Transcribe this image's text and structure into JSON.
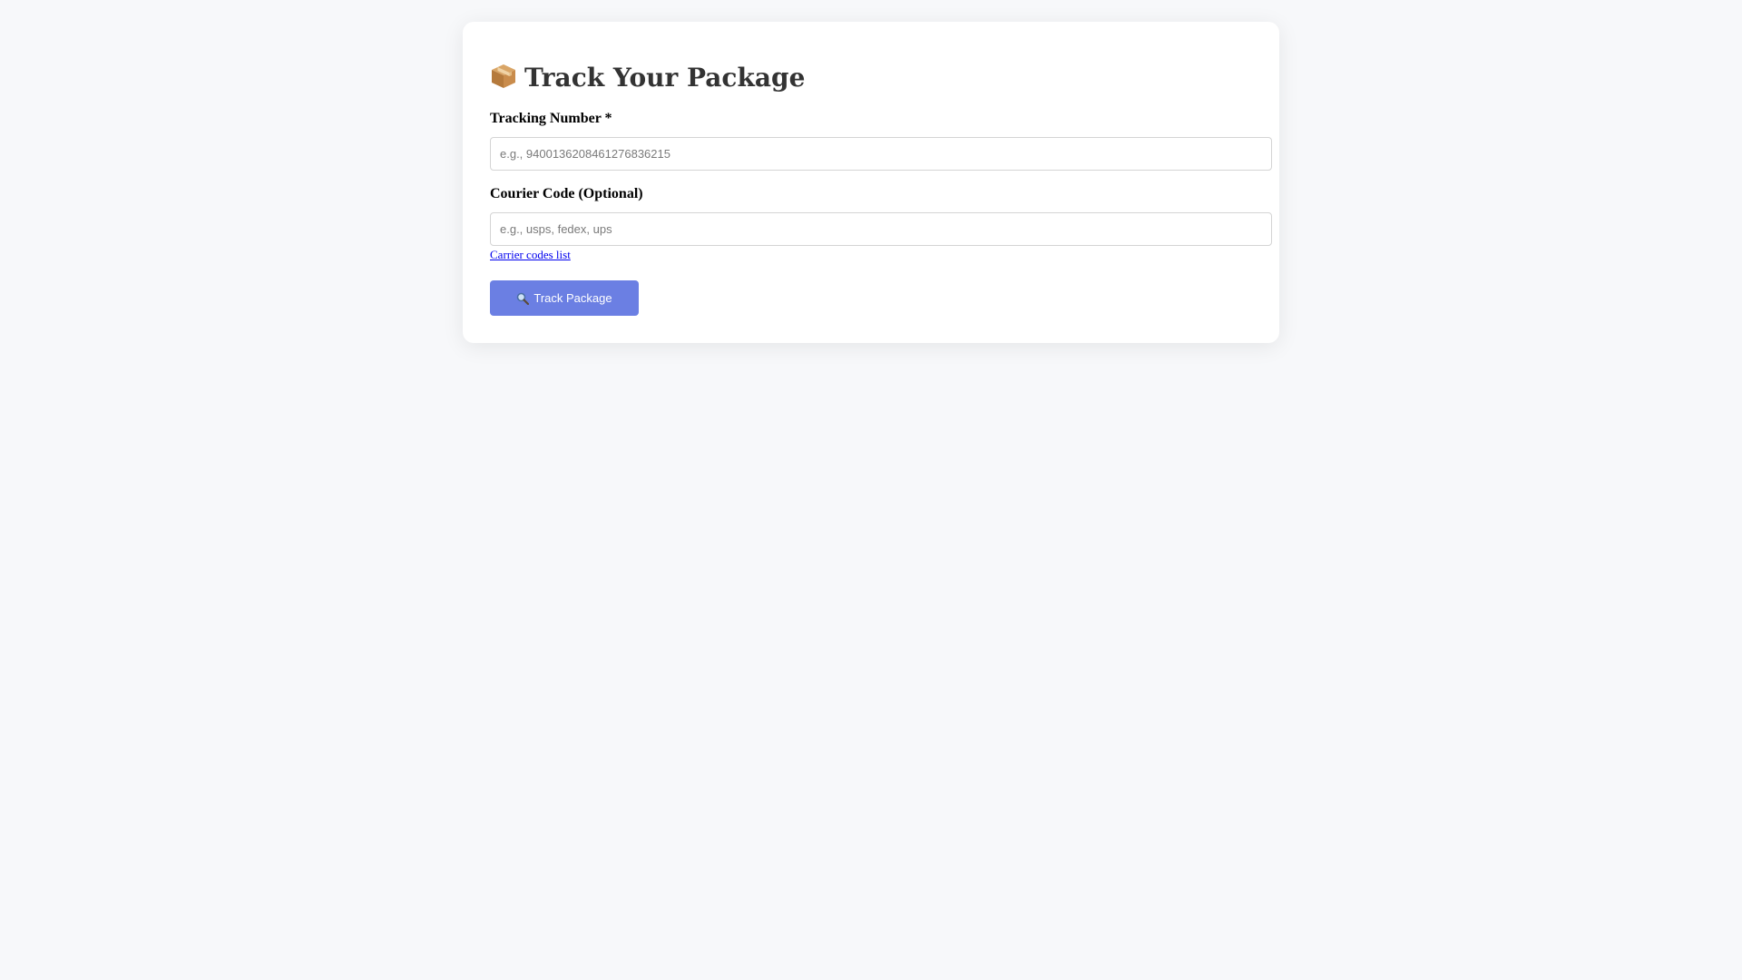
{
  "page": {
    "title": "Track Your Package",
    "title_icon": "package-icon"
  },
  "form": {
    "tracking_label": "Tracking Number *",
    "tracking_placeholder": "e.g., 9400136208461276836215",
    "tracking_value": "",
    "courier_label": "Courier Code (Optional)",
    "courier_placeholder": "e.g., usps, fedex, ups",
    "courier_value": "",
    "carrier_link_text": "Carrier codes list",
    "submit_label": "Track Package",
    "submit_icon": "magnifier-icon"
  },
  "colors": {
    "background": "#f7f8fa",
    "card": "#ffffff",
    "button": "#6b7fe3",
    "link": "#0000ee",
    "title_text": "#333333"
  }
}
